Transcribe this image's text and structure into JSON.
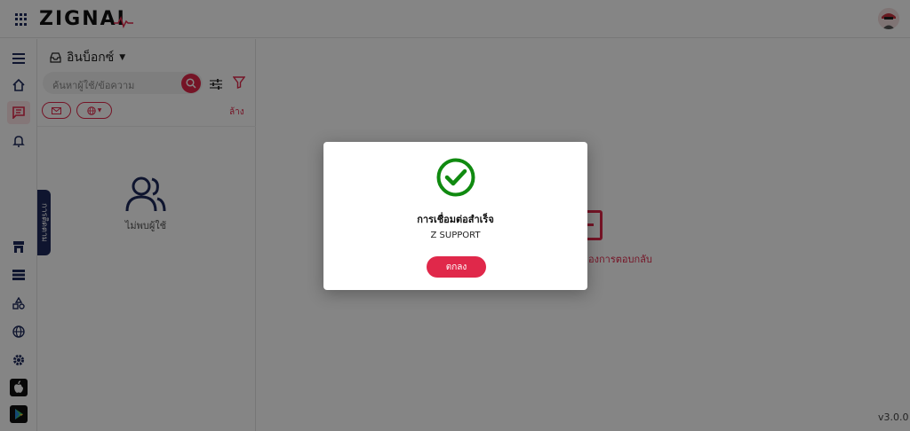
{
  "app": {
    "logo_text": "ZIGNAI",
    "version": "v3.0.0"
  },
  "inbox": {
    "title": "อินบ็อกซ์",
    "search_placeholder": "ค้นหาผู้ใช้/ข้อความ",
    "clear_label": "ล้าง",
    "empty_label": "ไม่พบผู้ใช้",
    "side_tab_label": "การติดตาม"
  },
  "main": {
    "empty_label": "องการตอบกลับ"
  },
  "modal": {
    "title": "การเชื่อมต่อสำเร็จ",
    "subtitle": "Z SUPPORT",
    "ok_label": "ตกลง"
  },
  "colors": {
    "accent": "#e0284a",
    "nav_dark": "#1e2a5a",
    "success": "#108a10"
  },
  "icons": {
    "nav": [
      "menu-icon",
      "home-icon",
      "chat-icon",
      "bell-icon",
      "store-icon",
      "list-icon",
      "shapes-icon",
      "globe-icon",
      "gear-icon",
      "apple-icon",
      "play-store-icon"
    ]
  }
}
